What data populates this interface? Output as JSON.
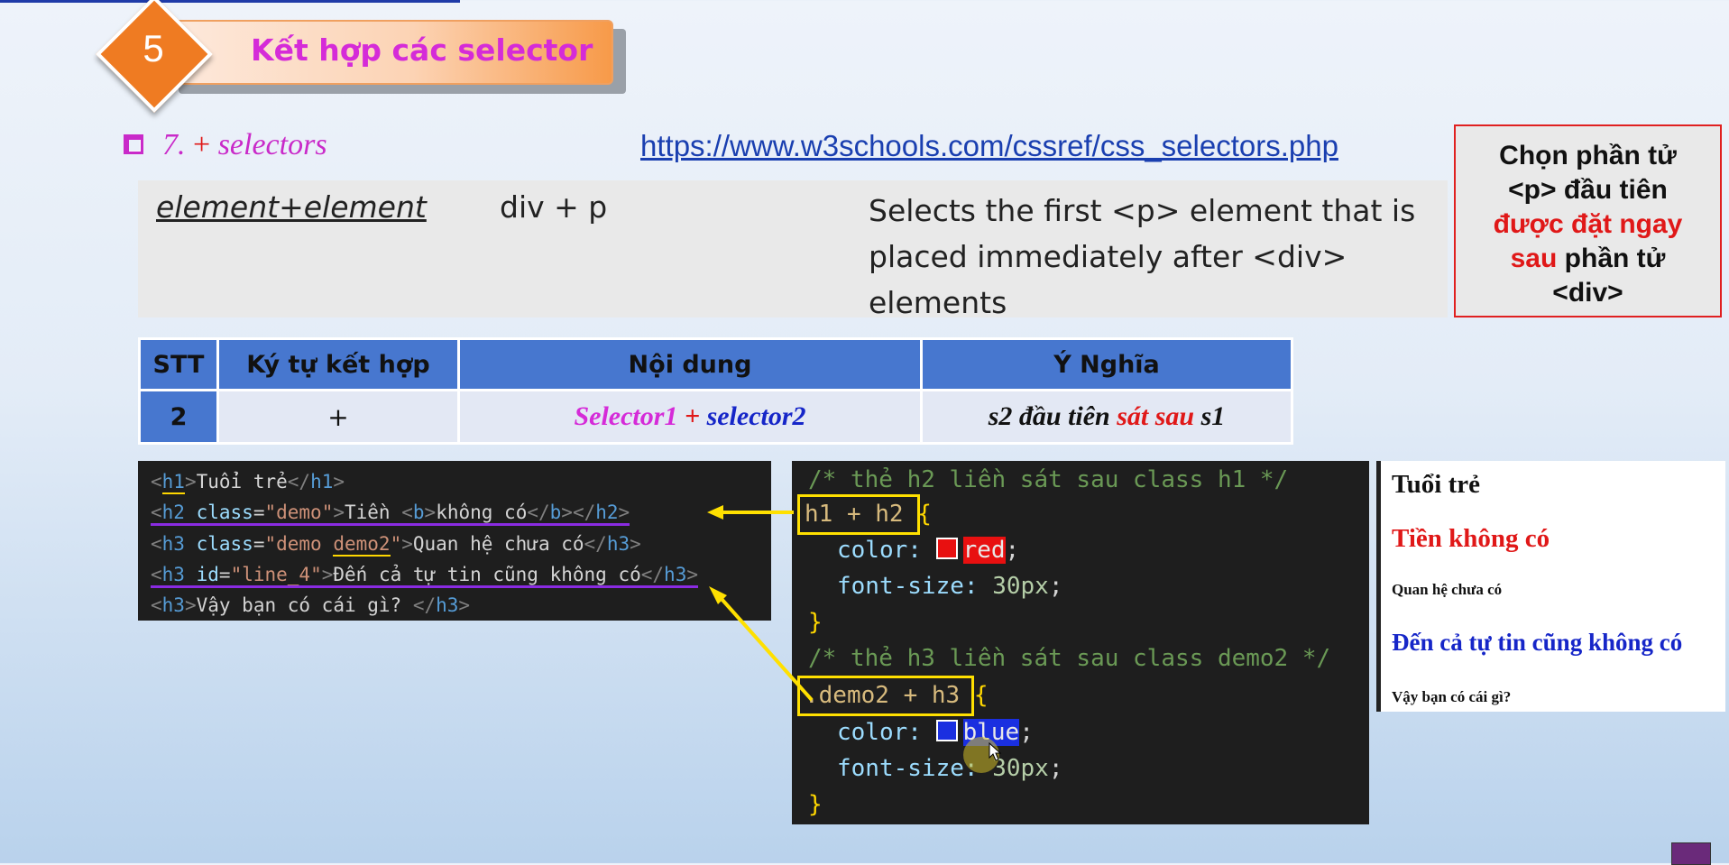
{
  "header": {
    "number": "5",
    "title": "Kết hợp các selector"
  },
  "section": {
    "index": "7.",
    "plus": "+",
    "title": "selectors",
    "link": "https://www.w3schools.com/cssref/css_selectors.php"
  },
  "w3": {
    "selector": "element+element",
    "example": "div + p",
    "description": "Selects the first <p> element that is placed immediately after <div> elements"
  },
  "note": {
    "line1": "Chọn phần tử",
    "line2": "<p> đầu tiên",
    "line3": "được đặt ngay",
    "line4_red": "sau",
    "line4": " phần tử",
    "line5": "<div>"
  },
  "table": {
    "headers": [
      "STT",
      "Ký tự kết hợp",
      "Nội dung",
      "Ý Nghĩa"
    ],
    "row": {
      "stt": "2",
      "symbol": "+",
      "content_a": "Selector1",
      "content_plus": " + ",
      "content_b": "selector2",
      "meaning_a": "s2 đầu tiên ",
      "meaning_b": "sát sau",
      "meaning_c": " s1"
    }
  },
  "html_code": {
    "l1": {
      "open": "<",
      "tag": "h1",
      "close": ">",
      "text": "Tuổi trẻ",
      "end": "</",
      "endtag": "h1",
      "endclose": ">"
    },
    "l2": {
      "tag": "h2",
      "attr": "class",
      "val": "\"demo\"",
      "text": "Tiền ",
      "b_text": "không có",
      "btag": "b",
      "endtag": "h2"
    },
    "l3": {
      "tag": "h3",
      "attr": "class",
      "val_a": "\"demo ",
      "val_b": "demo2",
      "val_c": "\"",
      "text": "Quan hệ chưa có",
      "endtag": "h3"
    },
    "l4": {
      "tag": "h3",
      "attr": "id",
      "val": "\"line_4\"",
      "text": "Đến cả tự tin cũng không có",
      "endtag": "h3"
    },
    "l5": {
      "tag": "h3",
      "text": "Vậy bạn có cái gì? ",
      "endtag": "h3"
    }
  },
  "css_code": {
    "c1": "/* thẻ h2 liền sát sau class h1 */",
    "sel1": "h1 + h2",
    "brace_open": "{",
    "prop_color": "color:",
    "val_red": "red",
    "semi": ";",
    "prop_size": "font-size:",
    "val_size": "30px",
    "brace_close": "}",
    "c2": "/* thẻ h3 liền sát sau class demo2 */",
    "sel2": ".demo2 + h3",
    "val_blue": "blue"
  },
  "output": {
    "h1": "Tuổi trẻ",
    "h2": "Tiền không có",
    "h3a": "Quan hệ chưa có",
    "h3b": "Đến cả tự tin cũng không có",
    "h3c": "Vậy bạn có cái gì?"
  },
  "colors": {
    "accent_orange": "#ef7b22",
    "magenta": "#d52bd8",
    "red": "#e01818",
    "blue": "#1626c8",
    "table_blue": "#4777cf"
  }
}
